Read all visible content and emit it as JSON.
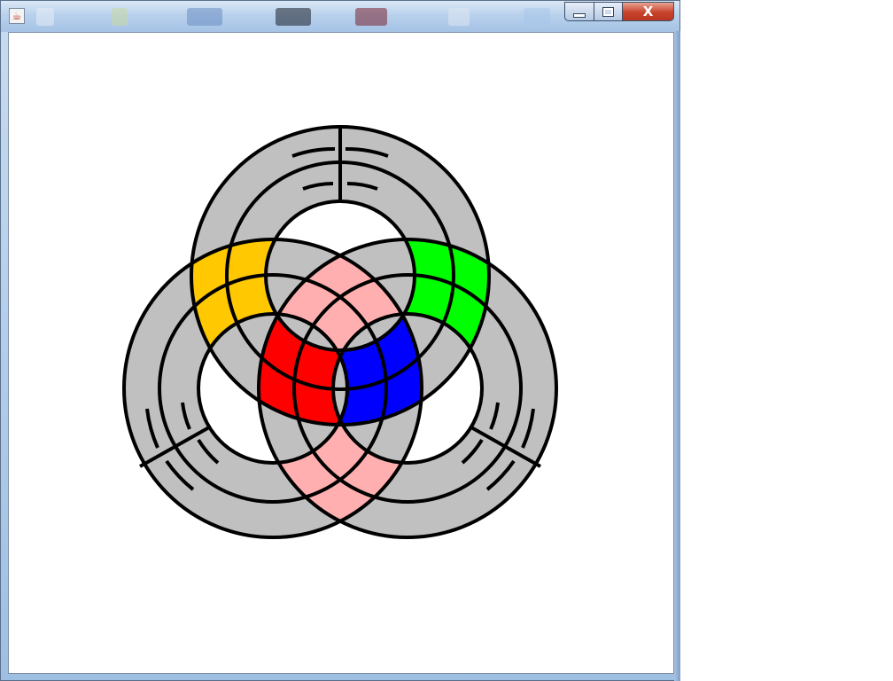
{
  "window": {
    "title": "",
    "controls": {
      "minimize": "minimize",
      "maximize": "maximize",
      "close": "X"
    }
  },
  "figure": {
    "colors": {
      "ring": "#c0c0c0",
      "stroke": "#000000",
      "pair_top_left": "#ffc800",
      "pair_top_right": "#00ff00",
      "pair_bottom": "#ffafaf",
      "triple_top": "#ffff00",
      "triple_left": "#0000ff",
      "triple_right": "#ff0000",
      "background": "#ffffff"
    }
  }
}
